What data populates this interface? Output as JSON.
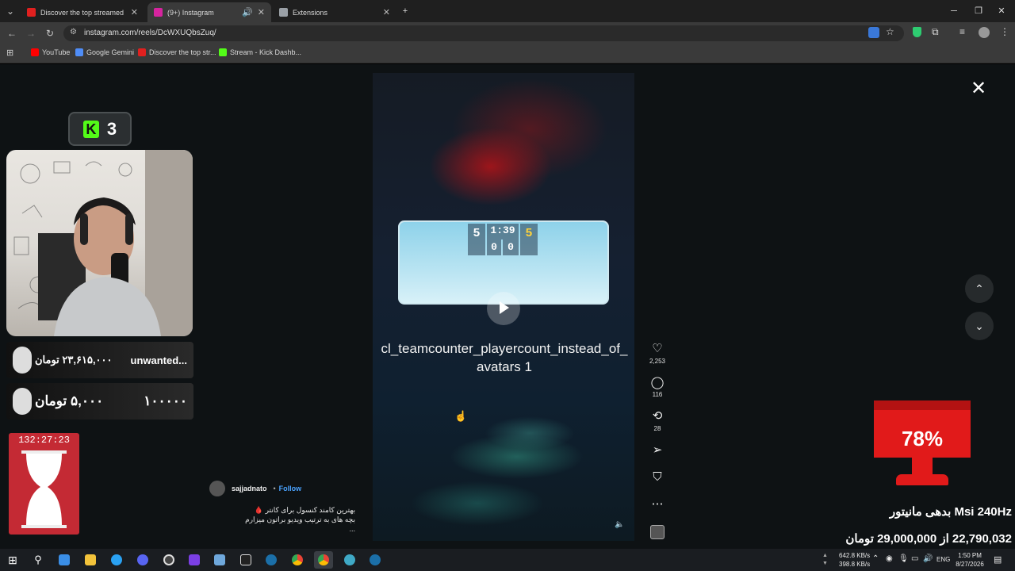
{
  "browser": {
    "tabs": [
      {
        "title": "Discover the top streamed mu",
        "favicon_color": "#e0201f",
        "active": false
      },
      {
        "title": "(9+) Instagram",
        "favicon_color": "#d6249f",
        "active": true
      },
      {
        "title": "Extensions",
        "favicon_color": "#9aa0a6",
        "active": false
      }
    ],
    "new_tab": "+",
    "url": "instagram.com/reels/DcWXUQbsZuq/",
    "bookmarks": [
      {
        "label": "YouTube",
        "color": "#ff0000"
      },
      {
        "label": "Google Gemini",
        "color": "#4f8df7"
      },
      {
        "label": "Discover the top str...",
        "color": "#e0201f"
      },
      {
        "label": "Stream - Kick Dashb...",
        "color": "#53fc18"
      }
    ]
  },
  "reel": {
    "hud": {
      "left_score": "5",
      "time": "1:39",
      "right_score": "5",
      "left_count": "0",
      "right_count": "0"
    },
    "caption": "cl_teamcounter_playercount_instead_of_avatars 1",
    "likes": "2,253",
    "comments": "116",
    "reposts": "28",
    "username": "sajjadnato",
    "follow": "Follow",
    "description_line1": "بهترین کامند کنسول برای کانتر 🩸",
    "description_line2": "بچه های به ترتیب ویدیو براتون میزارم",
    "more": "..."
  },
  "overlay": {
    "kick_count": "3",
    "donation1_amount": "۲۳,۶۱۵,۰۰۰ تومان",
    "donation1_name": "unwanted...",
    "donation2_amount": "۵,۰۰۰ تومان",
    "donation2_value": "۱۰۰۰۰۰",
    "timer": "132:27:23",
    "goal_percent_label": "78%",
    "goal_percent": 0.78,
    "goal_title": "Msi 240Hz بدهی مانیتور",
    "goal_amount": "22,790,032 از 29,000,000 تومان"
  },
  "taskbar": {
    "net_up": "642.8 KB/s",
    "net_down": "398.8 KB/s",
    "lang": "ENG",
    "time": "1:50 PM",
    "date": "8/27/2026"
  }
}
